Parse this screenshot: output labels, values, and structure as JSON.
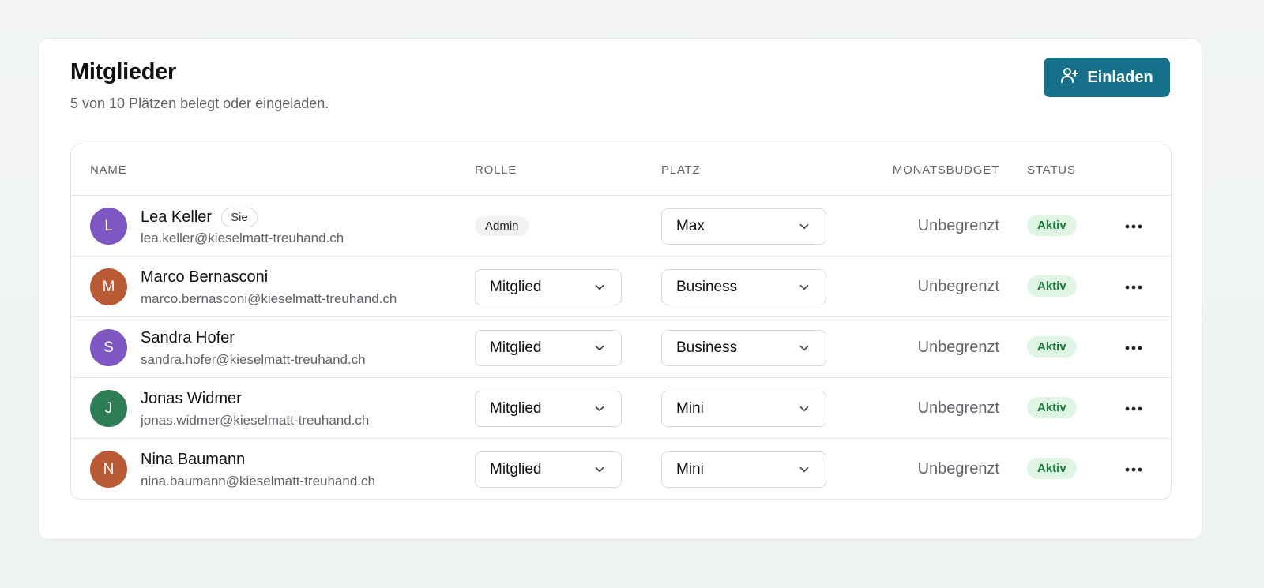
{
  "header": {
    "title": "Mitglieder",
    "subtitle": "5 von 10 Plätzen belegt oder eingeladen.",
    "invite_label": "Einladen"
  },
  "table": {
    "columns": {
      "name": "NAME",
      "role": "ROLLE",
      "seat": "PLATZ",
      "budget": "MONATSBUDGET",
      "status": "STATUS"
    },
    "rows": [
      {
        "initial": "L",
        "avatar_color": "#7e57c2",
        "name": "Lea Keller",
        "you_badge": "Sie",
        "email": "lea.keller@kieselmatt-treuhand.ch",
        "role": "Admin",
        "seat": "Max",
        "budget": "Unbegrenzt",
        "status": "Aktiv"
      },
      {
        "initial": "M",
        "avatar_color": "#b85a33",
        "name": "Marco Bernasconi",
        "email": "marco.bernasconi@kieselmatt-treuhand.ch",
        "role": "Mitglied",
        "seat": "Business",
        "budget": "Unbegrenzt",
        "status": "Aktiv"
      },
      {
        "initial": "S",
        "avatar_color": "#7e57c2",
        "name": "Sandra Hofer",
        "email": "sandra.hofer@kieselmatt-treuhand.ch",
        "role": "Mitglied",
        "seat": "Business",
        "budget": "Unbegrenzt",
        "status": "Aktiv"
      },
      {
        "initial": "J",
        "avatar_color": "#2e7d55",
        "name": "Jonas Widmer",
        "email": "jonas.widmer@kieselmatt-treuhand.ch",
        "role": "Mitglied",
        "seat": "Mini",
        "budget": "Unbegrenzt",
        "status": "Aktiv"
      },
      {
        "initial": "N",
        "avatar_color": "#b85a33",
        "name": "Nina Baumann",
        "email": "nina.baumann@kieselmatt-treuhand.ch",
        "role": "Mitglied",
        "seat": "Mini",
        "budget": "Unbegrenzt",
        "status": "Aktiv"
      }
    ]
  },
  "colors": {
    "accent": "#16708a",
    "status_bg": "#dff5e4",
    "status_text": "#1e7a3a"
  },
  "icons": {
    "invite": "user-plus-icon",
    "dropdown": "chevron-down-icon",
    "more": "more-horizontal-icon"
  }
}
